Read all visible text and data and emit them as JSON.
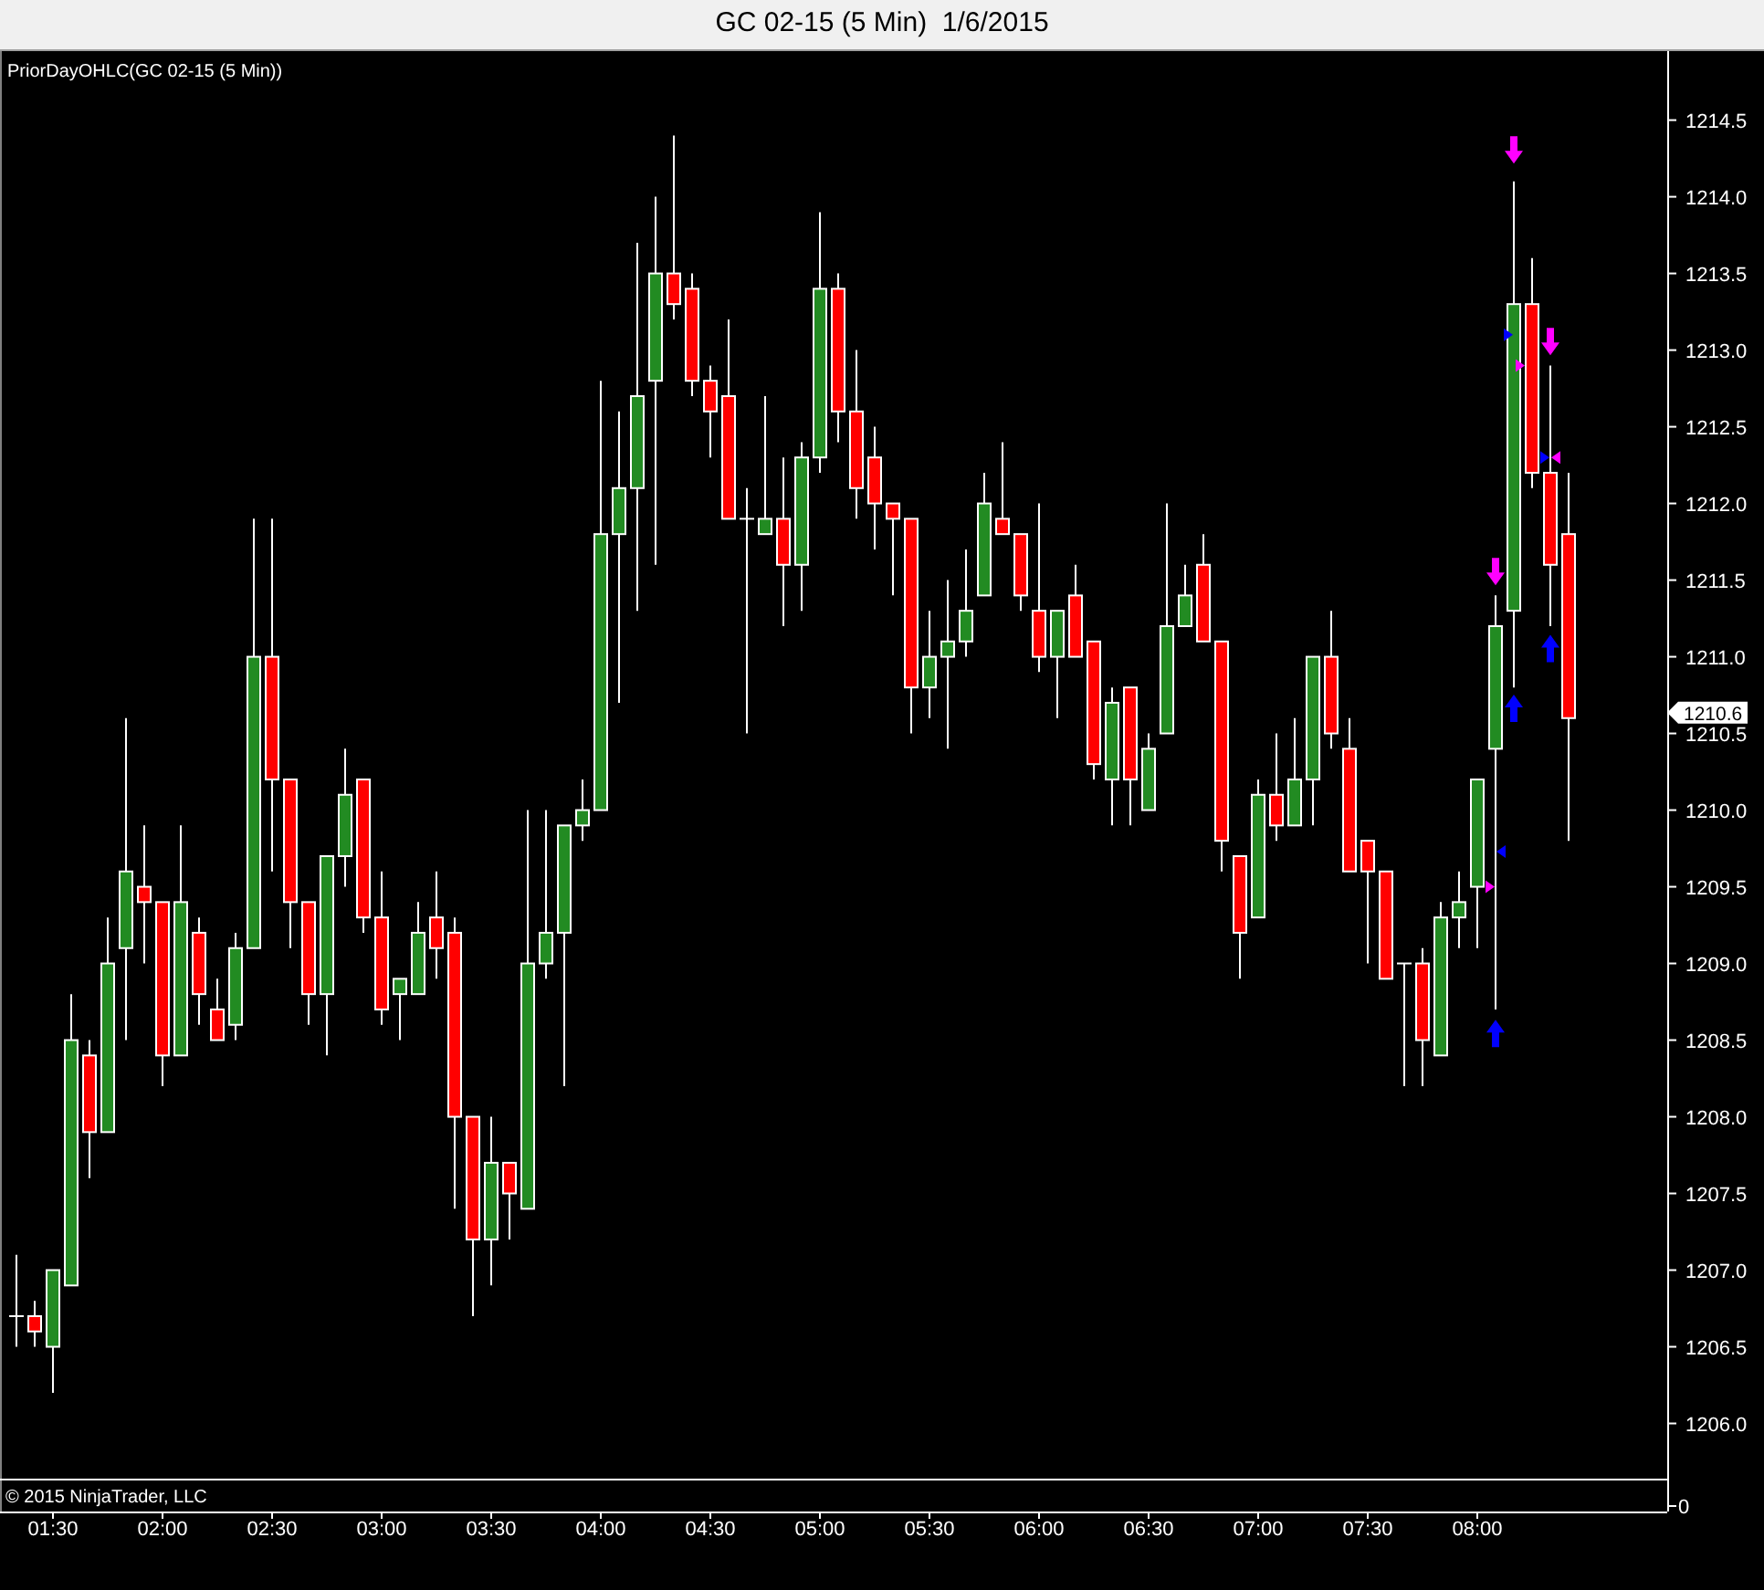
{
  "window": {
    "title": "GC 02-15 (5 Min)  1/6/2015"
  },
  "chart": {
    "indicator_label": "PriorDayOHLC(GC 02-15 (5 Min))",
    "last_price_tag": "1210.6",
    "lower_axis_label": "0",
    "copyright": "© 2015 NinjaTrader, LLC",
    "markers": [
      {
        "kind": "arrow-down",
        "color": "#ff00ff"
      },
      {
        "kind": "arrow-down",
        "color": "#ff00ff"
      },
      {
        "kind": "arrow-down",
        "color": "#ff00ff"
      },
      {
        "kind": "arrow-up",
        "color": "#0000ff"
      },
      {
        "kind": "arrow-up",
        "color": "#0000ff"
      },
      {
        "kind": "arrow-up",
        "color": "#0000ff"
      },
      {
        "kind": "triangle-right",
        "color": "#0000ff"
      },
      {
        "kind": "triangle-right",
        "color": "#ff00ff"
      },
      {
        "kind": "triangle-right",
        "color": "#0000ff"
      },
      {
        "kind": "triangle-left",
        "color": "#ff00ff"
      },
      {
        "kind": "triangle-right",
        "color": "#ff00ff"
      },
      {
        "kind": "triangle-left",
        "color": "#0000ff"
      }
    ],
    "chart_data": {
      "type": "candlestick",
      "ylim": [
        1205.64,
        1214.95
      ],
      "categories": [
        null,
        null,
        "01:30",
        null,
        null,
        null,
        null,
        null,
        "02:00",
        null,
        null,
        null,
        null,
        null,
        "02:30",
        null,
        null,
        null,
        null,
        null,
        "03:00",
        null,
        null,
        null,
        null,
        null,
        "03:30",
        null,
        null,
        null,
        null,
        null,
        "04:00",
        null,
        null,
        null,
        null,
        null,
        "04:30",
        null,
        null,
        null,
        null,
        null,
        "05:00",
        null,
        null,
        null,
        null,
        null,
        "05:30",
        null,
        null,
        null,
        null,
        null,
        "06:00",
        null,
        null,
        null,
        null,
        null,
        "06:30",
        null,
        null,
        null,
        null,
        null,
        "07:00",
        null,
        null,
        null,
        null,
        null,
        "07:30",
        null,
        null,
        null,
        null,
        null,
        "08:00",
        null,
        null,
        null,
        null,
        null
      ],
      "yticks": [
        {
          "value": 1206,
          "label": "1206.0"
        },
        {
          "value": 1206.5,
          "label": "1206.5"
        },
        {
          "value": 1207,
          "label": "1207.0"
        },
        {
          "value": 1207.5,
          "label": "1207.5"
        },
        {
          "value": 1208,
          "label": "1208.0"
        },
        {
          "value": 1208.5,
          "label": "1208.5"
        },
        {
          "value": 1209,
          "label": "1209.0"
        },
        {
          "value": 1209.5,
          "label": "1209.5"
        },
        {
          "value": 1210,
          "label": "1210.0"
        },
        {
          "value": 1210.5,
          "label": "1210.5"
        },
        {
          "value": 1211,
          "label": "1211.0"
        },
        {
          "value": 1211.5,
          "label": "1211.5"
        },
        {
          "value": 1212,
          "label": "1212.0"
        },
        {
          "value": 1212.5,
          "label": "1212.5"
        },
        {
          "value": 1213,
          "label": "1213.0"
        },
        {
          "value": 1213.5,
          "label": "1213.5"
        },
        {
          "value": 1214,
          "label": "1214.0"
        },
        {
          "value": 1214.5,
          "label": "1214.5"
        }
      ],
      "ohlc": [
        [
          1206.7,
          1207.1,
          1206.5,
          1206.7
        ],
        [
          1206.7,
          1206.8,
          1206.5,
          1206.6
        ],
        [
          1206.5,
          1207.0,
          1206.2,
          1207.0
        ],
        [
          1206.9,
          1208.8,
          1206.9,
          1208.5
        ],
        [
          1208.4,
          1208.5,
          1207.6,
          1207.9
        ],
        [
          1207.9,
          1209.3,
          1207.9,
          1209.0
        ],
        [
          1209.1,
          1210.6,
          1208.5,
          1209.6
        ],
        [
          1209.5,
          1209.9,
          1209.0,
          1209.4
        ],
        [
          1209.4,
          1209.4,
          1208.2,
          1208.4
        ],
        [
          1208.4,
          1209.9,
          1208.4,
          1209.4
        ],
        [
          1209.2,
          1209.3,
          1208.6,
          1208.8
        ],
        [
          1208.7,
          1208.9,
          1208.5,
          1208.5
        ],
        [
          1208.6,
          1209.2,
          1208.5,
          1209.1
        ],
        [
          1209.1,
          1211.9,
          1209.1,
          1211.0
        ],
        [
          1211.0,
          1211.9,
          1209.6,
          1210.2
        ],
        [
          1210.2,
          1210.2,
          1209.1,
          1209.4
        ],
        [
          1209.4,
          1209.4,
          1208.6,
          1208.8
        ],
        [
          1208.8,
          1209.7,
          1208.4,
          1209.7
        ],
        [
          1209.7,
          1210.4,
          1209.5,
          1210.1
        ],
        [
          1210.2,
          1210.2,
          1209.2,
          1209.3
        ],
        [
          1209.3,
          1209.6,
          1208.6,
          1208.7
        ],
        [
          1208.8,
          1208.9,
          1208.5,
          1208.9
        ],
        [
          1208.8,
          1209.4,
          1208.8,
          1209.2
        ],
        [
          1209.3,
          1209.6,
          1208.9,
          1209.1
        ],
        [
          1209.2,
          1209.3,
          1207.4,
          1208.0
        ],
        [
          1208.0,
          1208.0,
          1206.7,
          1207.2
        ],
        [
          1207.2,
          1208.0,
          1206.9,
          1207.7
        ],
        [
          1207.7,
          1207.7,
          1207.2,
          1207.5
        ],
        [
          1207.4,
          1210.0,
          1207.4,
          1209.0
        ],
        [
          1209.0,
          1210.0,
          1208.9,
          1209.2
        ],
        [
          1209.2,
          1209.9,
          1208.2,
          1209.9
        ],
        [
          1209.9,
          1210.2,
          1209.8,
          1210.0
        ],
        [
          1210.0,
          1212.8,
          1210.0,
          1211.8
        ],
        [
          1211.8,
          1212.6,
          1210.7,
          1212.1
        ],
        [
          1212.1,
          1213.7,
          1211.3,
          1212.7
        ],
        [
          1212.8,
          1214.0,
          1211.6,
          1213.5
        ],
        [
          1213.5,
          1214.4,
          1213.2,
          1213.3
        ],
        [
          1213.4,
          1213.5,
          1212.7,
          1212.8
        ],
        [
          1212.8,
          1212.9,
          1212.3,
          1212.6
        ],
        [
          1212.7,
          1213.2,
          1211.9,
          1211.9
        ],
        [
          1211.9,
          1212.1,
          1210.5,
          1211.9
        ],
        [
          1211.8,
          1212.7,
          1211.8,
          1211.9
        ],
        [
          1211.9,
          1212.3,
          1211.2,
          1211.6
        ],
        [
          1211.6,
          1212.4,
          1211.3,
          1212.3
        ],
        [
          1212.3,
          1213.9,
          1212.2,
          1213.4
        ],
        [
          1213.4,
          1213.5,
          1212.4,
          1212.6
        ],
        [
          1212.6,
          1213.0,
          1211.9,
          1212.1
        ],
        [
          1212.3,
          1212.5,
          1211.7,
          1212.0
        ],
        [
          1212.0,
          1212.0,
          1211.4,
          1211.9
        ],
        [
          1211.9,
          1211.9,
          1210.5,
          1210.8
        ],
        [
          1210.8,
          1211.3,
          1210.6,
          1211.0
        ],
        [
          1211.0,
          1211.5,
          1210.4,
          1211.1
        ],
        [
          1211.1,
          1211.7,
          1211.0,
          1211.3
        ],
        [
          1211.4,
          1212.2,
          1211.4,
          1212.0
        ],
        [
          1211.9,
          1212.4,
          1211.8,
          1211.8
        ],
        [
          1211.8,
          1211.8,
          1211.3,
          1211.4
        ],
        [
          1211.3,
          1212.0,
          1210.9,
          1211.0
        ],
        [
          1211.0,
          1211.3,
          1210.6,
          1211.3
        ],
        [
          1211.4,
          1211.6,
          1211.0,
          1211.0
        ],
        [
          1211.1,
          1211.1,
          1210.2,
          1210.3
        ],
        [
          1210.2,
          1210.8,
          1209.9,
          1210.7
        ],
        [
          1210.8,
          1210.8,
          1209.9,
          1210.2
        ],
        [
          1210.0,
          1210.5,
          1210.0,
          1210.4
        ],
        [
          1210.5,
          1212.0,
          1210.5,
          1211.2
        ],
        [
          1211.2,
          1211.6,
          1211.2,
          1211.4
        ],
        [
          1211.6,
          1211.8,
          1211.1,
          1211.1
        ],
        [
          1211.1,
          1211.1,
          1209.6,
          1209.8
        ],
        [
          1209.7,
          1209.7,
          1208.9,
          1209.2
        ],
        [
          1209.3,
          1210.2,
          1209.3,
          1210.1
        ],
        [
          1210.1,
          1210.5,
          1209.8,
          1209.9
        ],
        [
          1209.9,
          1210.6,
          1209.9,
          1210.2
        ],
        [
          1210.2,
          1211.0,
          1209.9,
          1211.0
        ],
        [
          1211.0,
          1211.3,
          1210.4,
          1210.5
        ],
        [
          1210.4,
          1210.6,
          1209.6,
          1209.6
        ],
        [
          1209.8,
          1209.8,
          1209.0,
          1209.6
        ],
        [
          1209.6,
          1209.6,
          1208.9,
          1208.9
        ],
        [
          1209.0,
          1209.0,
          1208.2,
          1209.0
        ],
        [
          1209.0,
          1209.1,
          1208.2,
          1208.5
        ],
        [
          1208.4,
          1209.4,
          1208.4,
          1209.3
        ],
        [
          1209.3,
          1209.6,
          1209.1,
          1209.4
        ],
        [
          1209.5,
          1210.2,
          1209.1,
          1210.2
        ],
        [
          1210.4,
          1211.4,
          1208.7,
          1211.2
        ],
        [
          1211.3,
          1214.1,
          1210.8,
          1213.3
        ],
        [
          1213.3,
          1213.6,
          1212.1,
          1212.2
        ],
        [
          1212.2,
          1212.9,
          1211.2,
          1211.6
        ],
        [
          1211.8,
          1212.2,
          1209.8,
          1210.6
        ]
      ]
    }
  }
}
